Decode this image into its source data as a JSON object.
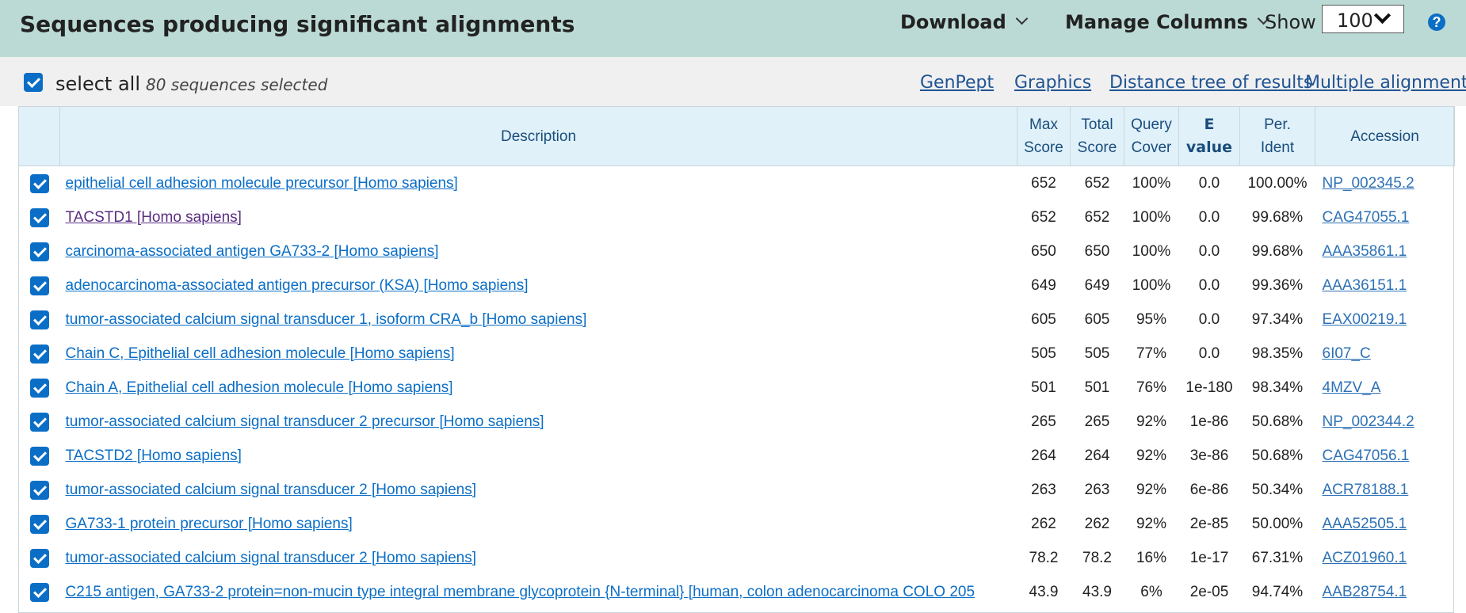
{
  "header": {
    "title": "Sequences producing significant alignments",
    "download_label": "Download",
    "manage_columns_label": "Manage Columns",
    "show_label": "Show",
    "show_value": "100",
    "help_label": "?"
  },
  "toolbar": {
    "select_all_label": "select all",
    "selected_count": "80 sequences selected",
    "links": [
      "GenPept",
      "Graphics",
      "Distance tree of results",
      "Multiple alignment"
    ]
  },
  "columns": {
    "description": "Description",
    "max_score": [
      "Max",
      "Score"
    ],
    "total_score": [
      "Total",
      "Score"
    ],
    "query_cover": [
      "Query",
      "Cover"
    ],
    "e_value": [
      "E",
      "value"
    ],
    "per_ident": [
      "Per.",
      "Ident"
    ],
    "accession": "Accession"
  },
  "rows": [
    {
      "description": "epithelial cell adhesion molecule precursor [Homo sapiens]",
      "max": "652",
      "total": "652",
      "cover": "100%",
      "evalue": "0.0",
      "ident": "100.00%",
      "accession": "NP_002345.2",
      "visited": false
    },
    {
      "description": "TACSTD1 [Homo sapiens]",
      "max": "652",
      "total": "652",
      "cover": "100%",
      "evalue": "0.0",
      "ident": "99.68%",
      "accession": "CAG47055.1",
      "visited": true
    },
    {
      "description": "carcinoma-associated antigen GA733-2 [Homo sapiens]",
      "max": "650",
      "total": "650",
      "cover": "100%",
      "evalue": "0.0",
      "ident": "99.68%",
      "accession": "AAA35861.1",
      "visited": false
    },
    {
      "description": "adenocarcinoma-associated antigen precursor (KSA) [Homo sapiens]",
      "max": "649",
      "total": "649",
      "cover": "100%",
      "evalue": "0.0",
      "ident": "99.36%",
      "accession": "AAA36151.1",
      "visited": false
    },
    {
      "description": "tumor-associated calcium signal transducer 1, isoform CRA_b [Homo sapiens]",
      "max": "605",
      "total": "605",
      "cover": "95%",
      "evalue": "0.0",
      "ident": "97.34%",
      "accession": "EAX00219.1",
      "visited": false
    },
    {
      "description": "Chain C, Epithelial cell adhesion molecule [Homo sapiens]",
      "max": "505",
      "total": "505",
      "cover": "77%",
      "evalue": "0.0",
      "ident": "98.35%",
      "accession": "6I07_C",
      "visited": false
    },
    {
      "description": "Chain A, Epithelial cell adhesion molecule [Homo sapiens]",
      "max": "501",
      "total": "501",
      "cover": "76%",
      "evalue": "1e-180",
      "ident": "98.34%",
      "accession": "4MZV_A",
      "visited": false
    },
    {
      "description": "tumor-associated calcium signal transducer 2 precursor [Homo sapiens]",
      "max": "265",
      "total": "265",
      "cover": "92%",
      "evalue": "1e-86",
      "ident": "50.68%",
      "accession": "NP_002344.2",
      "visited": false
    },
    {
      "description": "TACSTD2 [Homo sapiens]",
      "max": "264",
      "total": "264",
      "cover": "92%",
      "evalue": "3e-86",
      "ident": "50.68%",
      "accession": "CAG47056.1",
      "visited": false
    },
    {
      "description": "tumor-associated calcium signal transducer 2 [Homo sapiens]",
      "max": "263",
      "total": "263",
      "cover": "92%",
      "evalue": "6e-86",
      "ident": "50.34%",
      "accession": "ACR78188.1",
      "visited": false
    },
    {
      "description": "GA733-1 protein precursor [Homo sapiens]",
      "max": "262",
      "total": "262",
      "cover": "92%",
      "evalue": "2e-85",
      "ident": "50.00%",
      "accession": "AAA52505.1",
      "visited": false
    },
    {
      "description": "tumor-associated calcium signal transducer 2 [Homo sapiens]",
      "max": "78.2",
      "total": "78.2",
      "cover": "16%",
      "evalue": "1e-17",
      "ident": "67.31%",
      "accession": "ACZ01960.1",
      "visited": false
    },
    {
      "description": "C215 antigen, GA733-2 protein=non-mucin type integral membrane glycoprotein {N-terminal} [human, colon adenocarcinoma COLO 205",
      "max": "43.9",
      "total": "43.9",
      "cover": "6%",
      "evalue": "2e-05",
      "ident": "94.74%",
      "accession": "AAB28754.1",
      "visited": false
    }
  ]
}
